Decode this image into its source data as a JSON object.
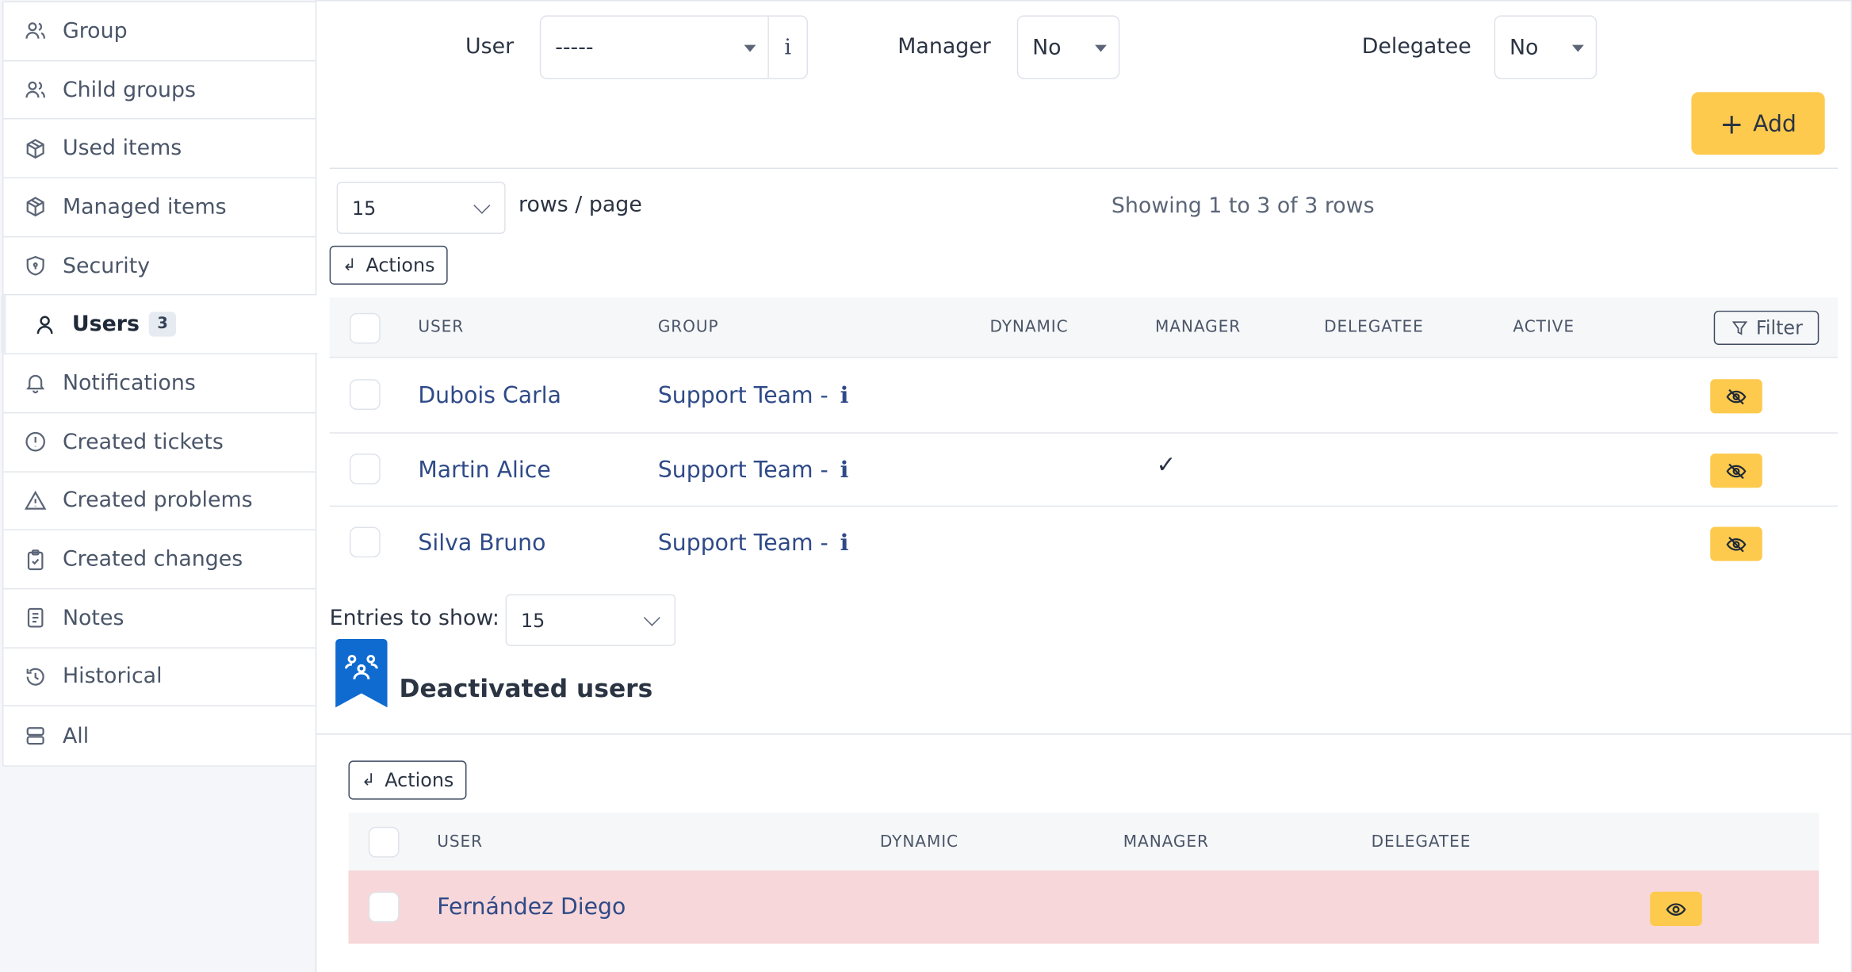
{
  "sidebar": {
    "items": [
      {
        "label": "Group",
        "icon": "users-icon"
      },
      {
        "label": "Child groups",
        "icon": "users-icon"
      },
      {
        "label": "Used items",
        "icon": "package-icon"
      },
      {
        "label": "Managed items",
        "icon": "package-icon"
      },
      {
        "label": "Security",
        "icon": "shield-icon"
      },
      {
        "label": "Users",
        "icon": "user-icon",
        "badge": "3",
        "active": true
      },
      {
        "label": "Notifications",
        "icon": "bell-icon"
      },
      {
        "label": "Created tickets",
        "icon": "alert-circle-icon"
      },
      {
        "label": "Created problems",
        "icon": "alert-triangle-icon"
      },
      {
        "label": "Created changes",
        "icon": "clipboard-check-icon"
      },
      {
        "label": "Notes",
        "icon": "notes-icon"
      },
      {
        "label": "Historical",
        "icon": "history-icon"
      },
      {
        "label": "All",
        "icon": "stack-icon"
      }
    ]
  },
  "form": {
    "user_label": "User",
    "user_value": "-----",
    "user_info": "i",
    "manager_label": "Manager",
    "manager_value": "No",
    "delegatee_label": "Delegatee",
    "delegatee_value": "No",
    "add_label": "Add",
    "add_plus": "+"
  },
  "pager": {
    "rows_value": "15",
    "rows_label": "rows / page",
    "showing": "Showing 1 to 3 of 3 rows",
    "actions_label": "Actions",
    "filter_label": "Filter"
  },
  "table": {
    "headers": {
      "user": "USER",
      "group": "GROUP",
      "dynamic": "DYNAMIC",
      "manager": "MANAGER",
      "delegatee": "DELEGATEE",
      "active": "ACTIVE"
    },
    "rows": [
      {
        "user": "Dubois Carla",
        "group": "Support Team -",
        "info": "i",
        "manager": ""
      },
      {
        "user": "Martin Alice",
        "group": "Support Team -",
        "info": "i",
        "manager": "✓"
      },
      {
        "user": "Silva Bruno",
        "group": "Support Team -",
        "info": "i",
        "manager": ""
      }
    ]
  },
  "entries": {
    "label": "Entries to show:",
    "value": "15"
  },
  "deactivated": {
    "title": "Deactivated users",
    "actions_label": "Actions",
    "headers": {
      "user": "USER",
      "dynamic": "DYNAMIC",
      "manager": "MANAGER",
      "delegatee": "DELEGATEE"
    },
    "rows": [
      {
        "user": "Fernández Diego"
      }
    ]
  },
  "colors": {
    "accent_yellow": "#fdca4d",
    "link_blue": "#2f4a88",
    "deactivated_row": "#f7d7d9",
    "ribbon_blue": "#0f6bd0"
  }
}
